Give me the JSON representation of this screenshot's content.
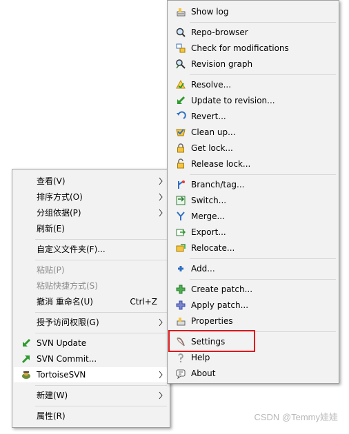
{
  "left_menu": {
    "view": "查看(V)",
    "sort": "排序方式(O)",
    "group": "分组依据(P)",
    "refresh": "刷新(E)",
    "customize": "自定义文件夹(F)...",
    "paste": "粘贴(P)",
    "paste_shortcut": "粘贴快捷方式(S)",
    "undo": "撤消 重命名(U)",
    "undo_shortcut": "Ctrl+Z",
    "grant_access": "授予访问权限(G)",
    "svn_update": "SVN Update",
    "svn_commit": "SVN Commit...",
    "tortoise": "TortoiseSVN",
    "new": "新建(W)",
    "properties": "属性(R)"
  },
  "right_menu": {
    "show_log": "Show log",
    "repo_browser": "Repo-browser",
    "check_mods": "Check for modifications",
    "revision_graph": "Revision graph",
    "resolve": "Resolve...",
    "update_rev": "Update to revision...",
    "revert": "Revert...",
    "cleanup": "Clean up...",
    "get_lock": "Get lock...",
    "release_lock": "Release lock...",
    "branch": "Branch/tag...",
    "switch": "Switch...",
    "merge": "Merge...",
    "export": "Export...",
    "relocate": "Relocate...",
    "add": "Add...",
    "create_patch": "Create patch...",
    "apply_patch": "Apply patch...",
    "properties": "Properties",
    "settings": "Settings",
    "help": "Help",
    "about": "About"
  },
  "watermark": "CSDN @Temmy娃娃",
  "colors": {
    "highlight_border": "#e0171b",
    "menu_bg": "#f2f2f2"
  }
}
